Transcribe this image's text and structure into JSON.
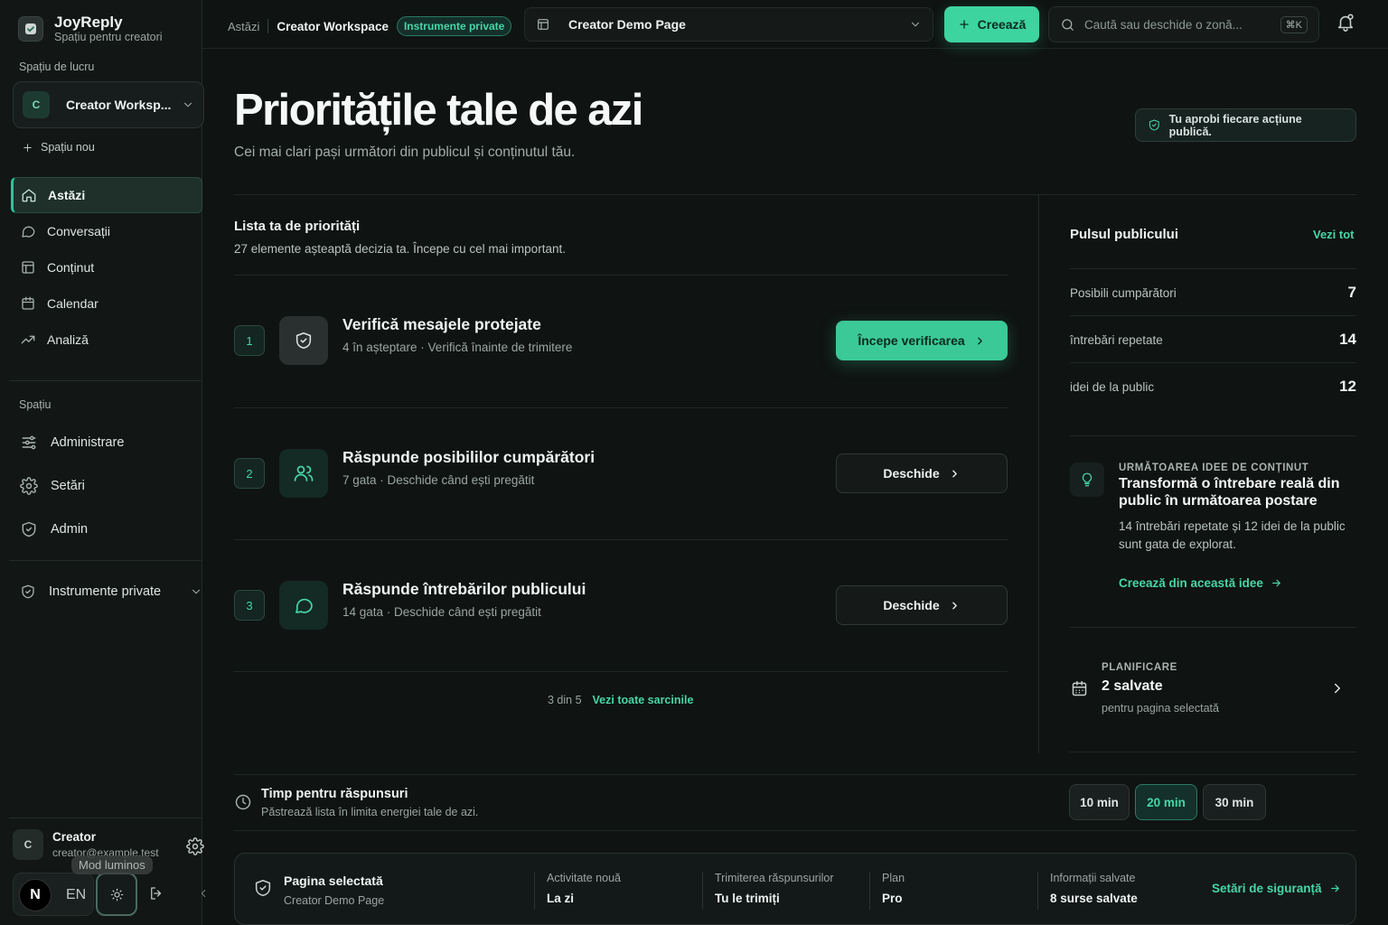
{
  "app": {
    "name": "JoyReply",
    "tagline": "Spațiu pentru creatori"
  },
  "sidebar": {
    "workspace_label": "Spațiu de lucru",
    "workspace": {
      "avatar": "C",
      "name": "Creator Worksp..."
    },
    "new_space": "Spațiu nou",
    "nav": [
      {
        "label": "Astăzi",
        "icon": "home-icon",
        "active": true
      },
      {
        "label": "Conversații",
        "icon": "chat-icon"
      },
      {
        "label": "Conținut",
        "icon": "content-icon"
      },
      {
        "label": "Calendar",
        "icon": "calendar-icon"
      },
      {
        "label": "Analiză",
        "icon": "trend-icon"
      }
    ],
    "space_label": "Spațiu",
    "space_nav": [
      {
        "label": "Administrare",
        "icon": "sliders-icon"
      },
      {
        "label": "Setări",
        "icon": "gear-icon"
      },
      {
        "label": "Admin",
        "icon": "shield-icon"
      }
    ],
    "private_tools": "Instrumente private",
    "user": {
      "avatar": "C",
      "name": "Creator",
      "email": "creator@example.test"
    },
    "n_badge": "N",
    "lang": "EN",
    "theme_tooltip": "Mod luminos"
  },
  "topbar": {
    "crumb_home": "Astăzi",
    "crumb_current": "Creator Workspace",
    "crumb_badge": "Instrumente private",
    "page_select": "Creator Demo Page",
    "create_label": "Creează",
    "search_placeholder": "Caută sau deschide o zonă...",
    "search_kbd": "⌘K"
  },
  "hero": {
    "title": "Prioritățile tale de azi",
    "subtitle": "Cei mai clari pași următori din publicul și conținutul tău.",
    "approve_note": "Tu aprobi fiecare acțiune publică."
  },
  "priorities": {
    "title": "Lista ta de priorități",
    "subtitle": "27 elemente așteaptă decizia ta. Începe cu cel mai important.",
    "tasks": [
      {
        "num": "1",
        "title": "Verifică mesajele protejate",
        "meta": "4 în așteptare · Verifică înainte de trimitere",
        "button": "Începe verificarea",
        "icon": "shield-check-icon"
      },
      {
        "num": "2",
        "title": "Răspunde posibililor cumpărători",
        "meta": "7 gata · Deschide când ești pregătit",
        "button": "Deschide",
        "icon": "users-icon"
      },
      {
        "num": "3",
        "title": "Răspunde întrebărilor publicului",
        "meta": "14 gata · Deschide când ești pregătit",
        "button": "Deschide",
        "icon": "message-icon"
      }
    ],
    "pager_count": "3 din 5",
    "pager_link": "Vezi toate sarcinile"
  },
  "pulse": {
    "title": "Pulsul publicului",
    "see_all": "Vezi tot",
    "stats": [
      {
        "label": "Posibili cumpărători",
        "value": "7"
      },
      {
        "label": "întrebări repetate",
        "value": "14"
      },
      {
        "label": "idei de la public",
        "value": "12"
      }
    ]
  },
  "idea": {
    "kicker": "URMĂTOAREA IDEE DE CONȚINUT",
    "title": "Transformă o întrebare reală din public în următoarea postare",
    "body": "14 întrebări repetate și 12 idei de la public sunt gata de explorat.",
    "link": "Creează din această idee"
  },
  "planning": {
    "kicker": "PLANIFICARE",
    "value": "2 salvate",
    "sub": "pentru pagina selectată"
  },
  "time": {
    "title": "Timp pentru răspunsuri",
    "subtitle": "Păstrează lista în limita energiei tale de azi.",
    "options": [
      "10 min",
      "20 min",
      "30 min"
    ],
    "selected": "20 min"
  },
  "selected_page": {
    "title": "Pagina selectată",
    "page": "Creator Demo Page",
    "columns": [
      {
        "label": "Activitate nouă",
        "value": "La zi"
      },
      {
        "label": "Trimiterea răspunsurilor",
        "value": "Tu le trimiți"
      },
      {
        "label": "Plan",
        "value": "Pro"
      },
      {
        "label": "Informații salvate",
        "value": "8 surse salvate"
      }
    ],
    "link": "Setări de siguranță"
  },
  "colors": {
    "accent": "#3dd4a0",
    "background": "#0f1312",
    "sidebar": "#121716"
  }
}
